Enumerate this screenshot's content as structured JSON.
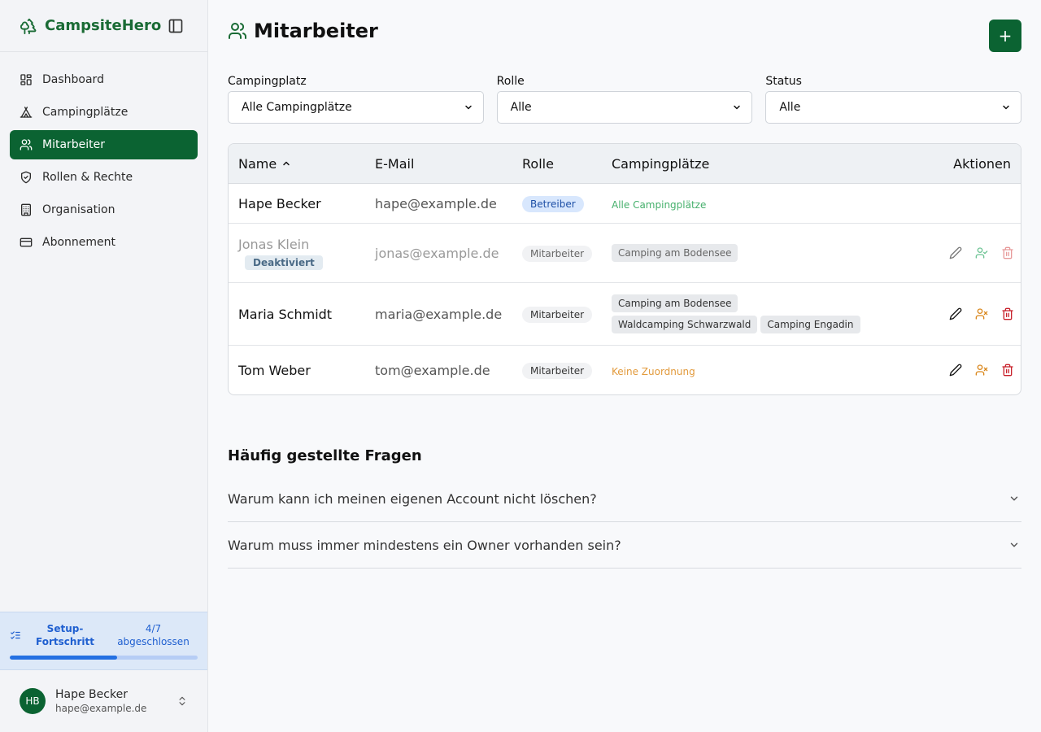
{
  "app": {
    "name": "CampsiteHero",
    "brand_color": "#0b6332"
  },
  "sidebar": {
    "items": [
      {
        "label": "Dashboard",
        "icon": "dashboard-icon"
      },
      {
        "label": "Campingplätze",
        "icon": "tent-icon"
      },
      {
        "label": "Mitarbeiter",
        "icon": "users-icon",
        "active": true
      },
      {
        "label": "Rollen & Rechte",
        "icon": "shield-icon"
      },
      {
        "label": "Organisation",
        "icon": "building-icon"
      },
      {
        "label": "Abonnement",
        "icon": "credit-card-icon"
      }
    ],
    "setup": {
      "label": "Setup-Fortschritt",
      "count": "4/7 abgeschlossen",
      "progress": 0.57
    },
    "user": {
      "initials": "HB",
      "name": "Hape Becker",
      "email": "hape@example.de"
    }
  },
  "page": {
    "title": "Mitarbeiter",
    "add_label": "+"
  },
  "filters": {
    "campingplatz": {
      "label": "Campingplatz",
      "value": "Alle Campingplätze"
    },
    "rolle": {
      "label": "Rolle",
      "value": "Alle"
    },
    "status": {
      "label": "Status",
      "value": "Alle"
    }
  },
  "table": {
    "headers": {
      "name": "Name",
      "email": "E-Mail",
      "role": "Rolle",
      "camps": "Campingplätze",
      "actions": "Aktionen"
    },
    "rows": [
      {
        "name": "Hape Becker",
        "email": "hape@example.de",
        "role": "Betreiber",
        "camps_note": "Alle Campingplätze"
      },
      {
        "name": "Jonas Klein",
        "status": "Deaktiviert",
        "email": "jonas@example.de",
        "role": "Mitarbeiter",
        "camps": [
          "Camping am Bodensee"
        ]
      },
      {
        "name": "Maria Schmidt",
        "email": "maria@example.de",
        "role": "Mitarbeiter",
        "camps": [
          "Camping am Bodensee",
          "Waldcamping Schwarzwald",
          "Camping Engadin"
        ]
      },
      {
        "name": "Tom Weber",
        "email": "tom@example.de",
        "role": "Mitarbeiter",
        "camps_note": "Keine Zuordnung"
      }
    ]
  },
  "faq": {
    "title": "Häufig gestellte Fragen",
    "items": [
      "Warum kann ich meinen eigenen Account nicht löschen?",
      "Warum muss immer mindestens ein Owner vorhanden sein?"
    ]
  }
}
